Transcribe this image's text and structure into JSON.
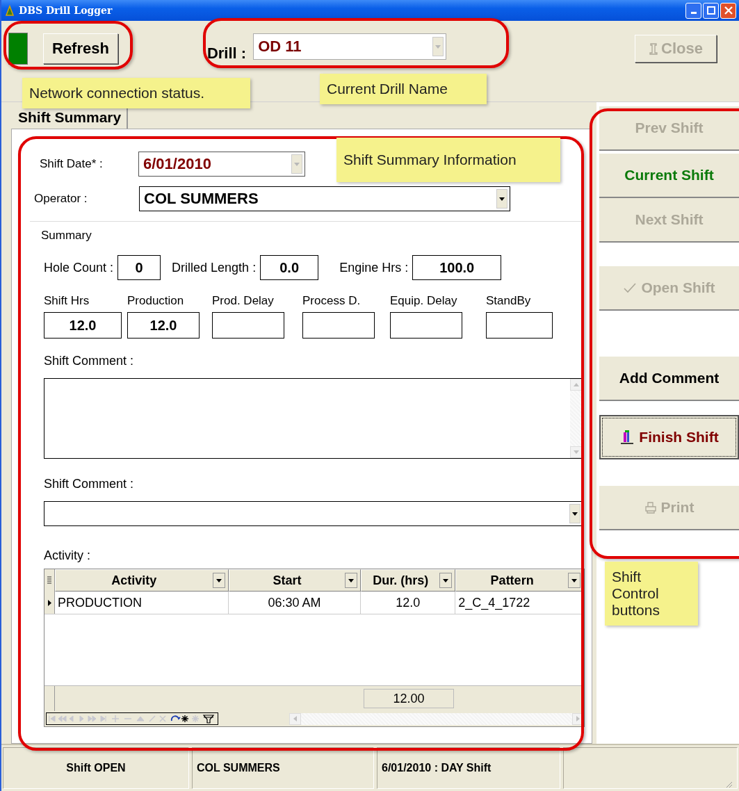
{
  "window": {
    "title": "DBS Drill Logger"
  },
  "toolbar": {
    "network_connected": true,
    "refresh_label": "Refresh",
    "drill_label": "Drill :",
    "drill_value": "OD 11",
    "close": {
      "label": "Close",
      "disabled": true
    }
  },
  "tabs": [
    {
      "label": "Shift Summary",
      "selected": true
    }
  ],
  "form": {
    "shift_date_label": "Shift Date* :",
    "shift_date": "6/01/2010",
    "operator_label": "Operator :",
    "operator": "COL SUMMERS",
    "summary_title": "Summary",
    "counts": [
      {
        "label": "Hole Count :",
        "value": "0"
      },
      {
        "label": "Drilled Length :",
        "value": "0.0"
      },
      {
        "label": "Engine Hrs :",
        "value": "100.0"
      }
    ],
    "hours": [
      {
        "label": "Shift Hrs",
        "value": "12.0"
      },
      {
        "label": "Production",
        "value": "12.0"
      },
      {
        "label": "Prod. Delay"
      },
      {
        "label": "Process D."
      },
      {
        "label": "Equip. Delay"
      },
      {
        "label": "StandBy"
      }
    ],
    "comment_label": "Shift Comment :",
    "comment_select_label": "Shift Comment :",
    "activity_label": "Activity :",
    "table": {
      "columns": [
        "Activity",
        "Start",
        "Dur. (hrs)",
        "Pattern"
      ],
      "rows": [
        {
          "cells": [
            "PRODUCTION",
            "06:30 AM",
            "12.0",
            "2_C_4_1722"
          ],
          "selected": true
        }
      ],
      "total": "12.00"
    }
  },
  "side_buttons": [
    {
      "label": "Prev Shift",
      "kind": "plain",
      "disabled": true,
      "focused": false
    },
    {
      "label": "Current Shift",
      "kind": "plain",
      "disabled": false,
      "focused": false,
      "color": "#0a7a0a"
    },
    {
      "label": "Next Shift",
      "kind": "plain",
      "disabled": true,
      "focused": false
    },
    {
      "label": "Open Shift",
      "kind": "check",
      "disabled": true,
      "focused": false
    },
    {
      "label": "Add Comment",
      "kind": "plain",
      "disabled": false,
      "focused": false
    },
    {
      "label": "Finish Shift",
      "kind": "drill",
      "disabled": false,
      "focused": true,
      "color": "#800000"
    },
    {
      "label": "Print",
      "kind": "printer",
      "disabled": true,
      "focused": false
    }
  ],
  "status_bar": [
    "Shift OPEN",
    "COL SUMMERS",
    "6/01/2010 : DAY Shift"
  ],
  "annotations": [
    {
      "text": "Network connection status."
    },
    {
      "text": "Current Drill Name"
    },
    {
      "text": "Shift Summary Information"
    },
    {
      "text": "Shift Control buttons"
    }
  ]
}
